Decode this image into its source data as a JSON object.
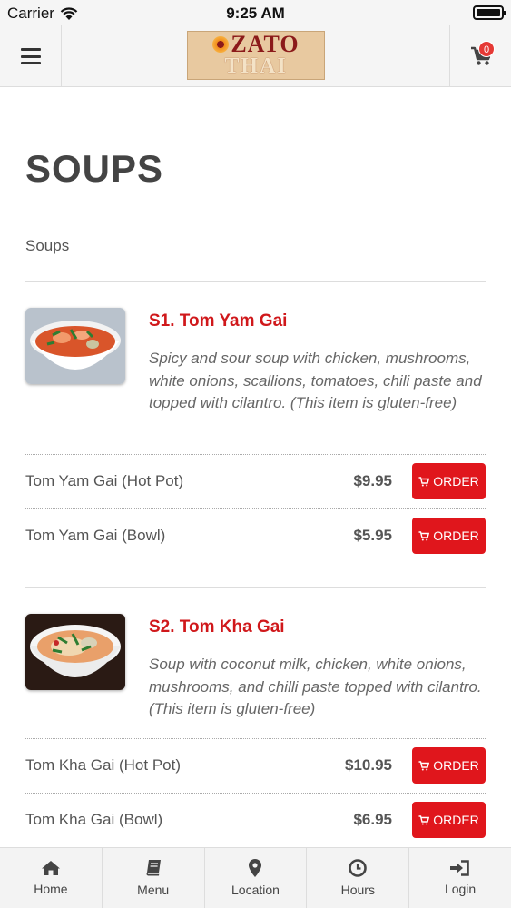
{
  "status_bar": {
    "carrier": "Carrier",
    "time": "9:25 AM"
  },
  "header": {
    "logo_top": "ZATO",
    "logo_bottom": "THAI",
    "cart_count": "0"
  },
  "page": {
    "title": "SOUPS",
    "category": "Soups"
  },
  "items": [
    {
      "name": "S1. Tom Yam Gai",
      "description": "Spicy and sour soup with chicken, mushrooms, white onions, scallions, tomatoes, chili paste and topped with cilantro. (This item is gluten-free)",
      "variants": [
        {
          "name": "Tom Yam Gai (Hot Pot)",
          "price": "$9.95",
          "button": "ORDER"
        },
        {
          "name": "Tom Yam Gai (Bowl)",
          "price": "$5.95",
          "button": "ORDER"
        }
      ]
    },
    {
      "name": "S2. Tom Kha Gai",
      "description": "Soup with coconut milk, chicken, white onions, mushrooms, and chilli paste topped with cilantro. (This item is gluten-free)",
      "variants": [
        {
          "name": "Tom Kha Gai (Hot Pot)",
          "price": "$10.95",
          "button": "ORDER"
        },
        {
          "name": "Tom Kha Gai (Bowl)",
          "price": "$6.95",
          "button": "ORDER"
        }
      ]
    }
  ],
  "bottom_nav": [
    {
      "label": "Home",
      "icon": "home-icon"
    },
    {
      "label": "Menu",
      "icon": "book-icon"
    },
    {
      "label": "Location",
      "icon": "map-pin-icon"
    },
    {
      "label": "Hours",
      "icon": "clock-icon"
    },
    {
      "label": "Login",
      "icon": "sign-in-icon"
    }
  ],
  "colors": {
    "accent": "#e0161c",
    "item_title": "#d0181b",
    "header_bg": "#f5f5f5"
  }
}
